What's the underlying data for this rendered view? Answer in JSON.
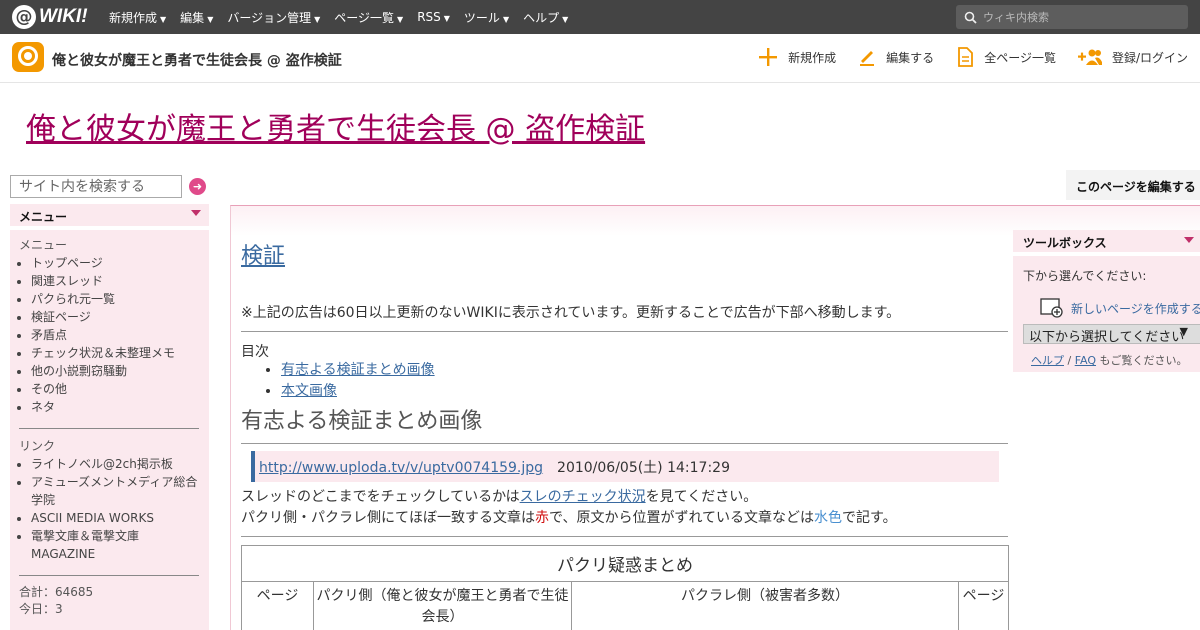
{
  "topbar": {
    "logo_mark": "@",
    "logo_text": "WIKI!",
    "nav": [
      "新規作成",
      "編集",
      "バージョン管理",
      "ページ一覧",
      "RSS",
      "ツール",
      "ヘルプ"
    ],
    "search_placeholder": "ウィキ内検索"
  },
  "subheader": {
    "site_title": "俺と彼女が魔王と勇者で生徒会長 @ 盗作検証",
    "actions": {
      "new": "新規作成",
      "edit": "編集する",
      "all_pages": "全ページ一覧",
      "login": "登録/ログイン"
    }
  },
  "page": {
    "big_title": "俺と彼女が魔王と勇者で生徒会長 @ 盗作検証"
  },
  "left": {
    "search_placeholder": "サイト内を検索する",
    "menu_title": "メニュー",
    "menu_head": "メニュー",
    "menu_items": [
      "トップページ",
      "関連スレッド",
      "パクられ元一覧",
      "検証ページ",
      "矛盾点",
      "チェック状況＆未整理メモ",
      "他の小説剽窃騒動",
      "その他",
      "ネタ"
    ],
    "links_head": "リンク",
    "links": [
      "ライトノベル@2ch掲示板",
      "アミューズメントメディア総合学院",
      "ASCII MEDIA WORKS",
      "電撃文庫＆電撃文庫MAGAZINE"
    ],
    "total": "合計：64685",
    "today": "今日：3"
  },
  "main": {
    "edit_button": "このページを編集する",
    "heading": "検証",
    "ad_note": "※上記の広告は60日以上更新のないWIKIに表示されています。更新することで広告が下部へ移動します。",
    "toc_label": "目次",
    "toc": [
      "有志よる検証まとめ画像",
      "本文画像"
    ],
    "section_heading": "有志よる検証まとめ画像",
    "quote_link": "http://www.uploda.tv/v/uptv0074159.jpg",
    "quote_date": "2010/06/05(土) 14:17:29",
    "line1_pre": "スレッドのどこまでをチェックしているかは",
    "line1_link": "スレのチェック状況",
    "line1_post": "を見てください。",
    "line2_a": "パクリ側・パクラレ側にてほぼ一致する文章は",
    "line2_red": "赤",
    "line2_b": "で、原文から位置がずれている文章などは",
    "line2_cyan": "水色",
    "line2_c": "で記す。",
    "table_caption": "パクリ疑惑まとめ",
    "table_headers": [
      "ページ",
      "パクリ側（俺と彼女が魔王と勇者で生徒会長）",
      "パクラレ側（被害者多数）",
      "ページ"
    ]
  },
  "toolbox": {
    "title": "ツールボックス",
    "choose": "下から選んでください:",
    "new_page": "新しいページを作成する",
    "select": "以下から選択してください",
    "help": "ヘルプ",
    "sep": " / ",
    "faq": "FAQ",
    "help_tail": " もご覧ください。"
  },
  "colors": {
    "accent": "#f39800",
    "title_link": "#a0005a",
    "link": "#3a6aa0",
    "panel_bg": "#fbe9ee"
  }
}
